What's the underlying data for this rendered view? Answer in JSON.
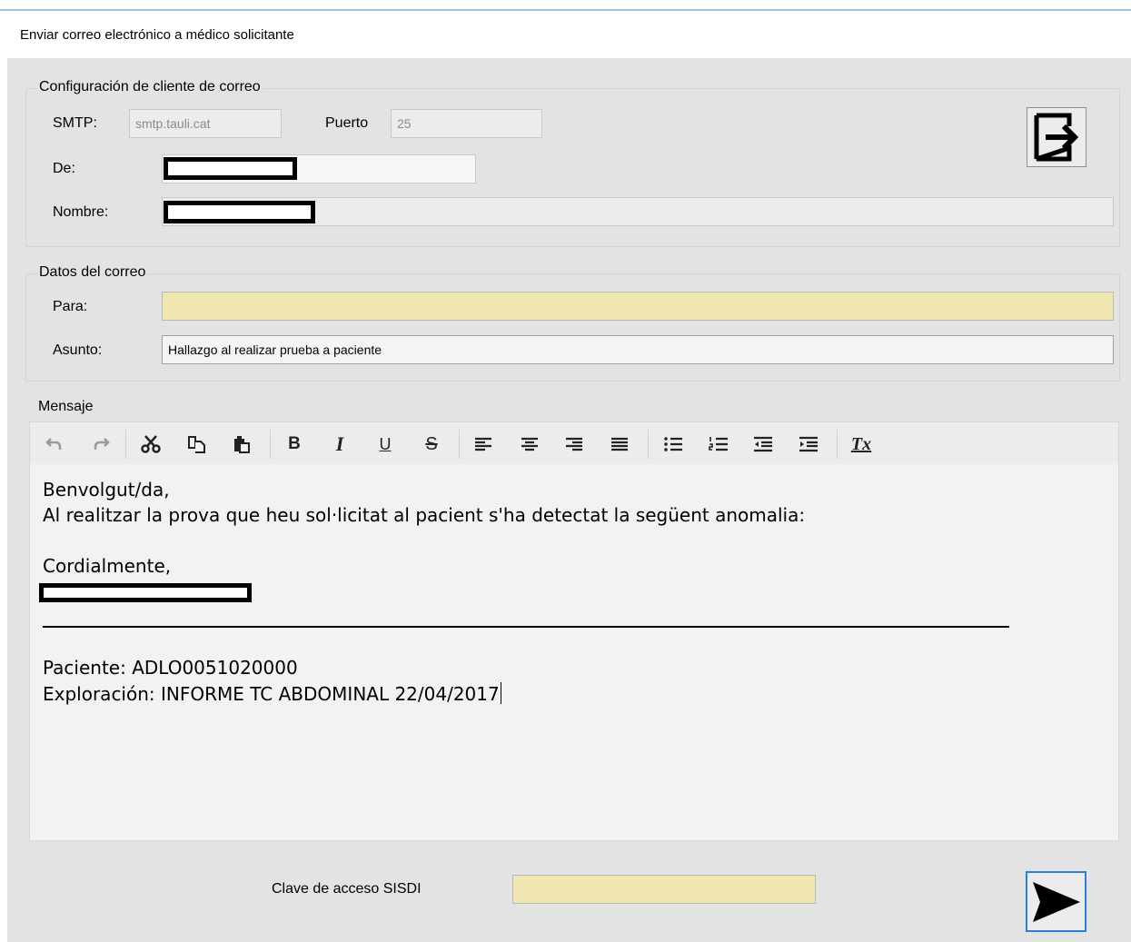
{
  "window": {
    "title": "Enviar correo electrónico a médico solicitante"
  },
  "config_group": {
    "legend": "Configuración de cliente de correo",
    "smtp_label": "SMTP:",
    "smtp_value": "smtp.tauli.cat",
    "port_label": "Puerto",
    "port_value": "25",
    "from_label": "De:",
    "name_label": "Nombre:"
  },
  "mail_group": {
    "legend": "Datos del correo",
    "to_label": "Para:",
    "to_value": "",
    "subject_label": "Asunto:",
    "subject_value": "Hallazgo al realizar prueba a paciente"
  },
  "message": {
    "legend": "Mensaje",
    "toolbar": [
      "undo-icon",
      "redo-icon",
      "cut-icon",
      "copy-icon",
      "paste-icon",
      "bold-icon",
      "italic-icon",
      "underline-icon",
      "strikethrough-icon",
      "align-left-icon",
      "align-center-icon",
      "align-right-icon",
      "align-justify-icon",
      "bulleted-list-icon",
      "numbered-list-icon",
      "outdent-icon",
      "indent-icon",
      "clear-formatting-icon"
    ],
    "toolbar_glyphs": {
      "bold": "B",
      "italic": "I",
      "underline": "U",
      "strike": "S",
      "clear": "Tx"
    },
    "lines": {
      "greeting": "Benvolgut/da,",
      "body": "Al realitzar la prova que heu sol·licitat al pacient s'ha detectat la següent anomalia:",
      "closing": "Cordialmente,",
      "patient": "Paciente: ADLO0051020000",
      "exploration": "Exploración: INFORME TC ABDOMINAL 22/04/2017"
    }
  },
  "footer": {
    "password_label": "Clave de acceso SISDI",
    "password_value": ""
  },
  "icons": {
    "exit": "exit-icon",
    "send": "send-icon"
  },
  "colors": {
    "required_field": "#f0e6b0",
    "panel": "#e3e3e3",
    "accent": "#2b7fd4"
  }
}
